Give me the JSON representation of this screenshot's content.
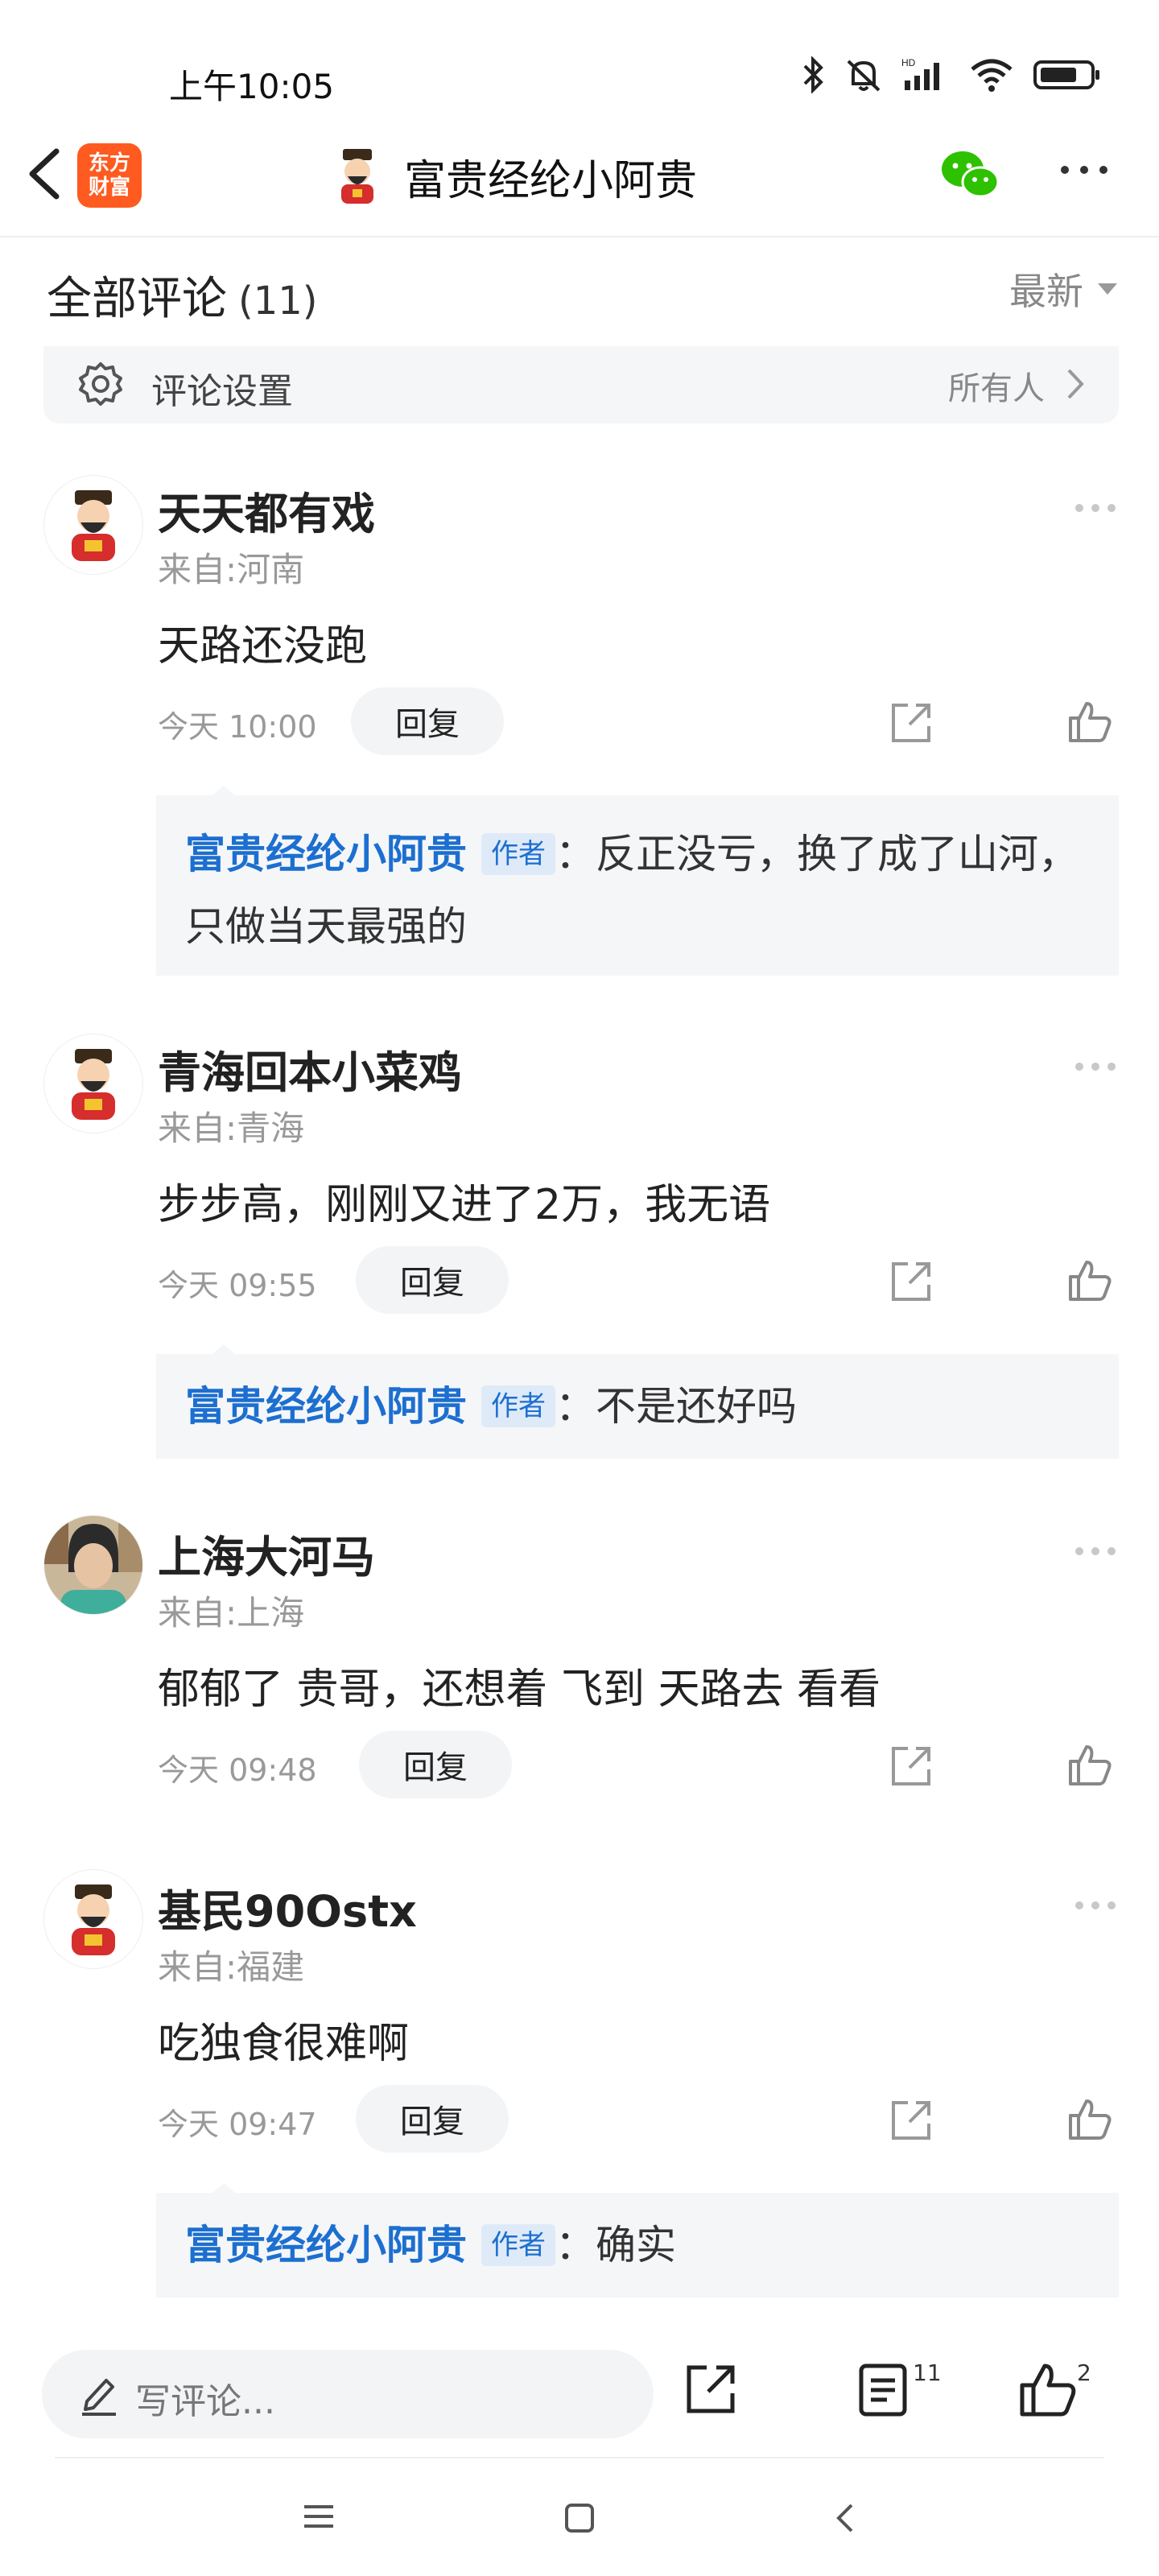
{
  "status_bar": {
    "time": "上午10:05",
    "icons": [
      "bluetooth-icon",
      "mute-bell-icon",
      "hd-signal-icon",
      "wifi-icon",
      "battery-icon"
    ]
  },
  "nav": {
    "app_logo_line1": "东方",
    "app_logo_line2": "财富",
    "title": "富贵经纶小阿贵",
    "accent_color": "#1c6fd0",
    "logo_color": "#ff5a1f",
    "wechat_color": "#2dc100"
  },
  "comments_header": {
    "title": "全部评论",
    "count": "(11)",
    "sort_label": "最新"
  },
  "settings": {
    "label": "评论设置",
    "scope": "所有人"
  },
  "comments": [
    {
      "name": "天天都有戏",
      "location": "来自:河南",
      "text": "天路还没跑",
      "time": "今天 10:00",
      "reply_label": "回复",
      "reply": {
        "author": "富贵经纶小阿贵",
        "tag": "作者",
        "text": "：反正没亏，换了成了山河，只做当天最强的"
      }
    },
    {
      "name": "青海回本小菜鸡",
      "location": "来自:青海",
      "text": "步步高，刚刚又进了2万，我无语",
      "time": "今天 09:55",
      "reply_label": "回复",
      "reply": {
        "author": "富贵经纶小阿贵",
        "tag": "作者",
        "text": "：不是还好吗"
      }
    },
    {
      "name": "上海大河马",
      "location": "来自:上海",
      "text": "郁郁了 贵哥，还想着 飞到 天路去 看看",
      "time": "今天 09:48",
      "reply_label": "回复"
    },
    {
      "name": "基民90Ostx",
      "location": "来自:福建",
      "text": "吃独食很难啊",
      "time": "今天 09:47",
      "reply_label": "回复",
      "reply": {
        "author": "富贵经纶小阿贵",
        "tag": "作者",
        "text": "：确实"
      }
    }
  ],
  "bottom_bar": {
    "placeholder": "写评论...",
    "comment_count": "11",
    "like_count": "2"
  }
}
